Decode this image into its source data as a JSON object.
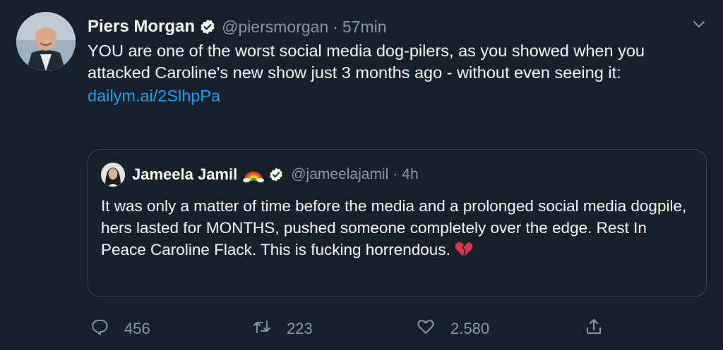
{
  "tweet": {
    "author_name": "Piers Morgan",
    "author_handle": "@piersmorgan",
    "separator": "·",
    "time": "57min",
    "text": "YOU are one of the worst social media dog-pilers, as you showed when you attacked Caroline's new show just 3 months ago - without even seeing it:",
    "link": "dailym.ai/2SlhpPa"
  },
  "quoted": {
    "author_name": "Jameela Jamil",
    "author_handle": "@jameelajamil",
    "separator": "·",
    "time": "4h",
    "text": "It was only a matter of time before the media and a prolonged social media dogpile, hers lasted for MONTHS, pushed someone completely over the edge. Rest In Peace Caroline Flack. This is fucking horrendous."
  },
  "actions": {
    "replies": "456",
    "retweets": "223",
    "likes": "2.580"
  },
  "icons": {
    "verified": "verified-badge-icon",
    "caret": "chevron-down-icon",
    "rainbow": "rainbow-emoji-icon",
    "broken_heart": "broken-heart-emoji-icon",
    "reply": "reply-icon",
    "retweet": "retweet-icon",
    "like": "heart-icon",
    "share": "share-icon"
  },
  "colors": {
    "background": "#15202b",
    "link": "#1da1f2",
    "secondary_text": "#8899a6",
    "border": "#38444d"
  }
}
